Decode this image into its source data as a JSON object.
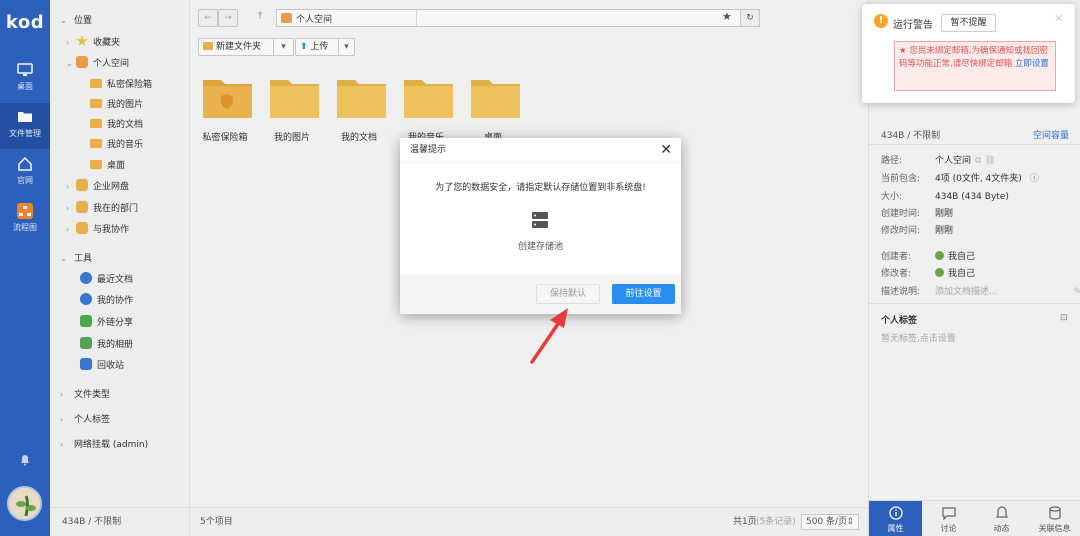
{
  "app": {
    "logo": "kod"
  },
  "rail": [
    {
      "label": "桌面",
      "icon": "monitor-icon"
    },
    {
      "label": "文件管理",
      "icon": "folder-icon"
    },
    {
      "label": "官网",
      "icon": "home-icon"
    },
    {
      "label": "流程图",
      "icon": "flowchart-icon"
    }
  ],
  "sidebar": {
    "location_header": "位置",
    "favorites": "收藏夹",
    "personal_space": "个人空间",
    "personal_children": [
      "私密保险箱",
      "我的图片",
      "我的文档",
      "我的音乐",
      "桌面"
    ],
    "enterprise": "企业网盘",
    "my_dept": "我在的部门",
    "collab": "与我协作",
    "tools_header": "工具",
    "tools": [
      "最近文档",
      "我的协作",
      "外链分享",
      "我的相册",
      "回收站"
    ],
    "file_types": "文件类型",
    "personal_tags": "个人标签",
    "network_mount": "网络挂载 (admin)",
    "footer": "434B / 不限制"
  },
  "main": {
    "path": "个人空间",
    "new_folder": "新建文件夹",
    "upload": "上传",
    "folders": [
      "私密保险箱",
      "我的图片",
      "我的文档",
      "我的音乐",
      "桌面"
    ],
    "status_left": "5个项目",
    "status_page": "共1页",
    "status_records": "(5条记录)",
    "status_perpage": "500 条/页"
  },
  "rpanel": {
    "capacity": "434B / 不限制",
    "space_link": "空间容量",
    "props": [
      {
        "k": "路径:",
        "v": "个人空间"
      },
      {
        "k": "当前包含:",
        "v": "4项 (0文件, 4文件夹)"
      },
      {
        "k": "大小:",
        "v": "434B (434 Byte)"
      },
      {
        "k": "创建时间:",
        "v": "刚刚"
      },
      {
        "k": "修改时间:",
        "v": "刚刚"
      },
      {
        "k": "创建者:",
        "v": "我自己"
      },
      {
        "k": "修改者:",
        "v": "我自己"
      },
      {
        "k": "描述说明:",
        "v": "添加文档描述..."
      }
    ],
    "tags_title": "个人标签",
    "tags_empty": "暂无标签,点击设置",
    "tabs": [
      "属性",
      "讨论",
      "动态",
      "关联信息"
    ]
  },
  "dialog": {
    "title": "温馨提示",
    "message": "为了您的数据安全，请指定默认存储位置到非系统盘!",
    "pool_label": "创建存储池",
    "btn_keep": "保持默认",
    "btn_go": "前往设置"
  },
  "toast": {
    "title": "运行警告",
    "dismiss": "暂不提醒",
    "warning": "★ 您尚未绑定邮箱,为确保通知或找回密码等功能正常,请尽快绑定邮箱",
    "link": "立即设置"
  },
  "colors": {
    "accent": "#2f64c3",
    "primary_button": "#2a8ef0",
    "warning": "#f5a623",
    "folder": "#f0b64e"
  }
}
